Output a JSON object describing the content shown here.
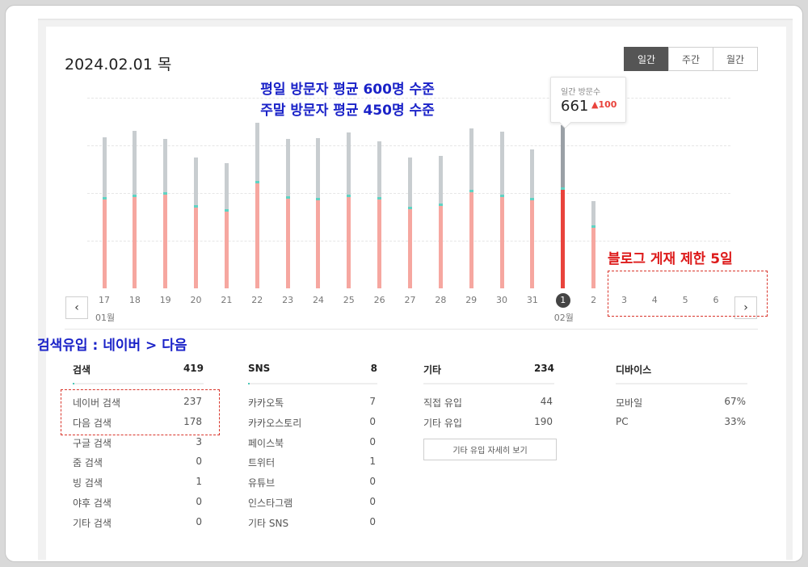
{
  "header": {
    "date": "2024.02.01 목"
  },
  "period_tabs": [
    {
      "label": "일간",
      "active": true
    },
    {
      "label": "주간",
      "active": false
    },
    {
      "label": "월간",
      "active": false
    }
  ],
  "annotations": {
    "weekday_note": "평일 방문자 평균 600명 수준",
    "weekend_note": "주말 방문자 평균 450명 수준",
    "blog_note": "블로그 게재 제한 5일",
    "search_note": "검색유입 : 네이버 > 다음"
  },
  "tooltip": {
    "label": "일간 방문수",
    "value": "661",
    "delta": "100"
  },
  "chart_data": {
    "type": "bar",
    "categories": [
      "17",
      "18",
      "19",
      "20",
      "21",
      "22",
      "23",
      "24",
      "25",
      "26",
      "27",
      "28",
      "29",
      "30",
      "31",
      "1",
      "2",
      "3",
      "4",
      "5",
      "6"
    ],
    "month_labels": [
      {
        "index": 0,
        "label": "01월"
      },
      {
        "index": 15,
        "label": "02월"
      }
    ],
    "selected_index": 15,
    "series": [
      {
        "values": [
          612,
          640,
          608,
          530,
          508,
          672,
          606,
          610,
          632,
          597,
          530,
          538,
          650,
          635,
          563,
          661,
          353,
          null,
          null,
          null,
          null
        ]
      },
      {
        "values": [
          362,
          371,
          379,
          327,
          310,
          426,
          363,
          359,
          372,
          360,
          322,
          333,
          389,
          372,
          357,
          401,
          245,
          null,
          null,
          null,
          null
        ]
      }
    ],
    "colors": {
      "total": "#c8cdd0",
      "total_selected": "#9aa0a6",
      "new": "#f6a7a0",
      "new_selected": "#e9433c",
      "divider": "#5fd3c3"
    },
    "grid": true
  },
  "stats": {
    "search": {
      "title": "검색",
      "total": "419",
      "rows": [
        {
          "label": "네이버 검색",
          "value": "237"
        },
        {
          "label": "다음 검색",
          "value": "178"
        },
        {
          "label": "구글 검색",
          "value": "3"
        },
        {
          "label": "줌 검색",
          "value": "0"
        },
        {
          "label": "빙 검색",
          "value": "1"
        },
        {
          "label": "야후 검색",
          "value": "0"
        },
        {
          "label": "기타 검색",
          "value": "0"
        }
      ]
    },
    "sns": {
      "title": "SNS",
      "total": "8",
      "rows": [
        {
          "label": "카카오톡",
          "value": "7"
        },
        {
          "label": "카카오스토리",
          "value": "0"
        },
        {
          "label": "페이스북",
          "value": "0"
        },
        {
          "label": "트위터",
          "value": "1"
        },
        {
          "label": "유튜브",
          "value": "0"
        },
        {
          "label": "인스타그램",
          "value": "0"
        },
        {
          "label": "기타 SNS",
          "value": "0"
        }
      ]
    },
    "other": {
      "title": "기타",
      "total": "234",
      "rows": [
        {
          "label": "직접 유입",
          "value": "44"
        },
        {
          "label": "기타 유입",
          "value": "190"
        }
      ],
      "detail_button": "기타 유입 자세히 보기"
    },
    "device": {
      "title": "디바이스",
      "rows": [
        {
          "label": "모바일",
          "value": "67%"
        },
        {
          "label": "PC",
          "value": "33%"
        }
      ]
    }
  },
  "icons": {
    "prev": "chevron-left-icon",
    "next": "chevron-right-icon",
    "up": "caret-up-icon"
  }
}
